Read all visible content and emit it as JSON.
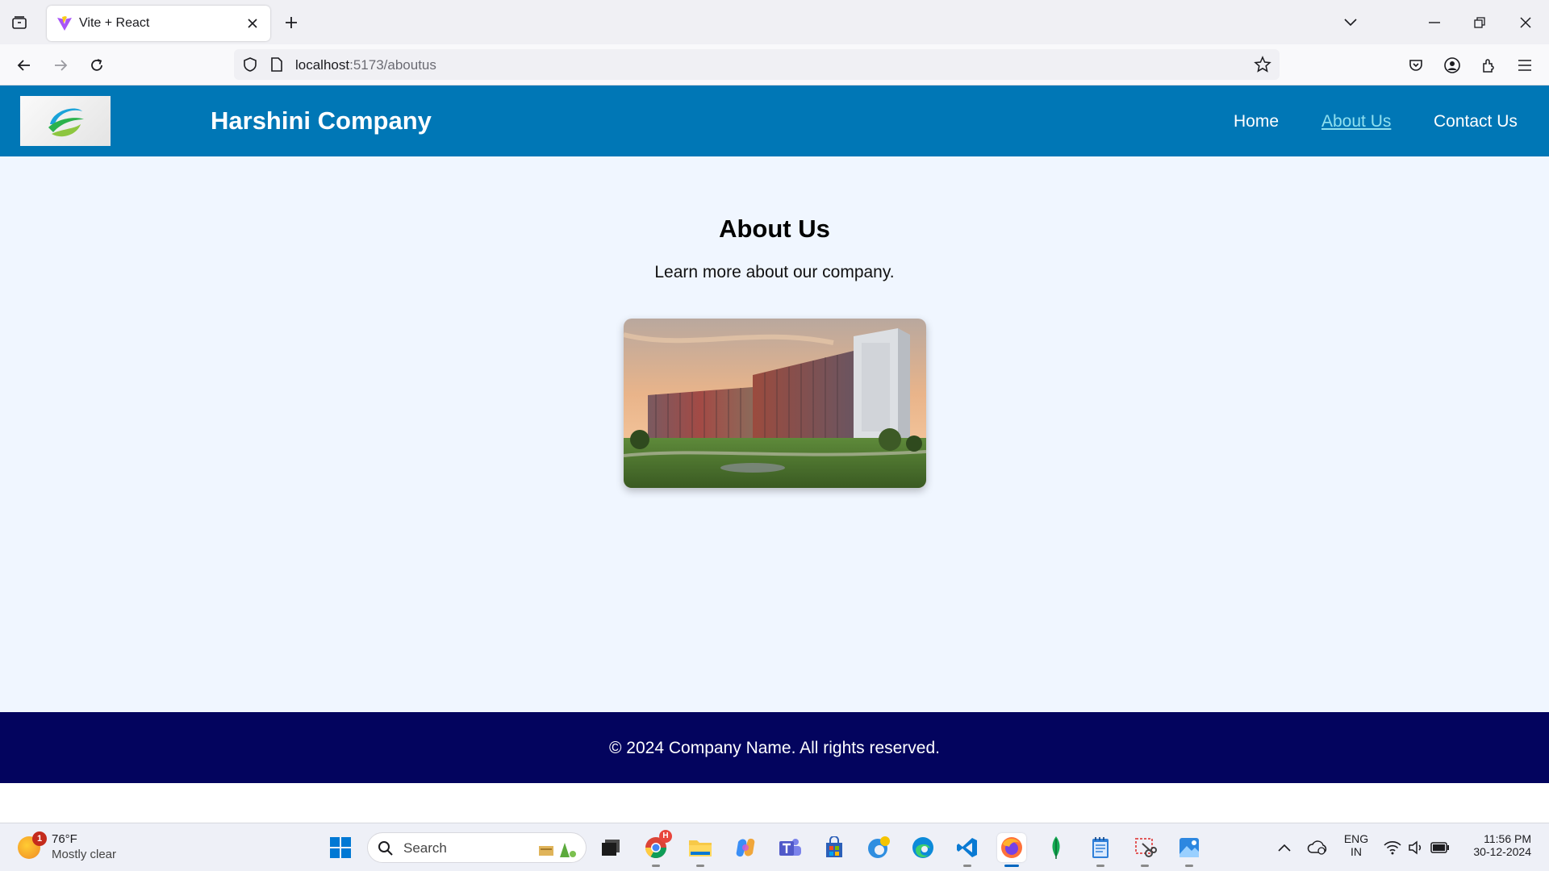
{
  "browser": {
    "tab_title": "Vite + React",
    "url_host": "localhost",
    "url_path": ":5173/aboutus"
  },
  "site": {
    "title": "Harshini Company",
    "nav": [
      {
        "label": "Home",
        "active": false
      },
      {
        "label": "About Us",
        "active": true
      },
      {
        "label": "Contact Us",
        "active": false
      }
    ]
  },
  "main": {
    "heading": "About Us",
    "subheading": "Learn more about our company."
  },
  "footer": {
    "text": "© 2024 Company Name. All rights reserved."
  },
  "taskbar": {
    "weather_temp": "76°F",
    "weather_condition": "Mostly clear",
    "weather_badge": "1",
    "search_label": "Search",
    "chrome_badge": "H",
    "language_top": "ENG",
    "language_bottom": "IN",
    "time": "11:56 PM",
    "date": "30-12-2024"
  },
  "colors": {
    "header": "#0077b6",
    "nav_active": "#90e0ef",
    "footer": "#03045e",
    "page_bg": "#f0f6ff"
  }
}
